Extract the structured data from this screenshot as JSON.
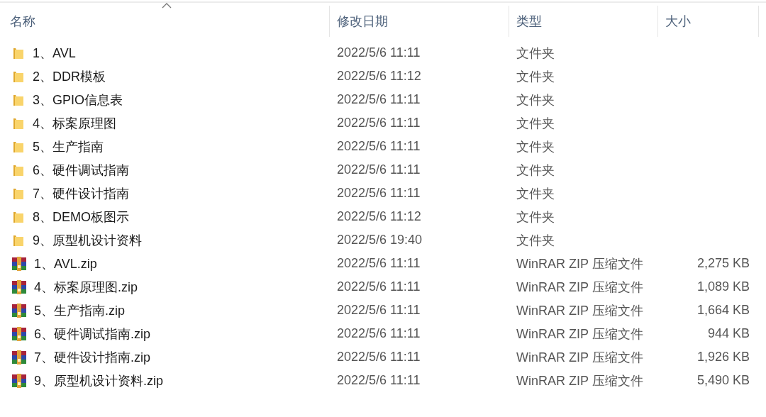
{
  "columns": [
    {
      "label": "名称",
      "sorted": true
    },
    {
      "label": "修改日期",
      "sorted": false
    },
    {
      "label": "类型",
      "sorted": false
    },
    {
      "label": "大小",
      "sorted": false
    }
  ],
  "rows": [
    {
      "kind": "folder",
      "name": "1、AVL",
      "date": "2022/5/6 11:11",
      "type": "文件夹"
    },
    {
      "kind": "folder",
      "name": "2、DDR模板",
      "date": "2022/5/6 11:12",
      "type": "文件夹"
    },
    {
      "kind": "folder",
      "name": "3、GPIO信息表",
      "date": "2022/5/6 11:11",
      "type": "文件夹"
    },
    {
      "kind": "folder",
      "name": "4、标案原理图",
      "date": "2022/5/6 11:11",
      "type": "文件夹"
    },
    {
      "kind": "folder",
      "name": "5、生产指南",
      "date": "2022/5/6 11:11",
      "type": "文件夹"
    },
    {
      "kind": "folder",
      "name": "6、硬件调试指南",
      "date": "2022/5/6 11:11",
      "type": "文件夹"
    },
    {
      "kind": "folder",
      "name": "7、硬件设计指南",
      "date": "2022/5/6 11:11",
      "type": "文件夹"
    },
    {
      "kind": "folder",
      "name": "8、DEMO板图示",
      "date": "2022/5/6 11:12",
      "type": "文件夹"
    },
    {
      "kind": "folder",
      "name": "9、原型机设计资料",
      "date": "2022/5/6 19:40",
      "type": "文件夹"
    },
    {
      "kind": "archive",
      "name": "1、AVL.zip",
      "date": "2022/5/6 11:11",
      "type": "WinRAR ZIP 压缩文件",
      "size": "2,275 KB"
    },
    {
      "kind": "archive",
      "name": "4、标案原理图.zip",
      "date": "2022/5/6 11:11",
      "type": "WinRAR ZIP 压缩文件",
      "size": "1,089 KB"
    },
    {
      "kind": "archive",
      "name": "5、生产指南.zip",
      "date": "2022/5/6 11:11",
      "type": "WinRAR ZIP 压缩文件",
      "size": "1,664 KB"
    },
    {
      "kind": "archive",
      "name": "6、硬件调试指南.zip",
      "date": "2022/5/6 11:11",
      "type": "WinRAR ZIP 压缩文件",
      "size": "944 KB"
    },
    {
      "kind": "archive",
      "name": "7、硬件设计指南.zip",
      "date": "2022/5/6 11:11",
      "type": "WinRAR ZIP 压缩文件",
      "size": "1,926 KB"
    },
    {
      "kind": "archive",
      "name": "9、原型机设计资料.zip",
      "date": "2022/5/6 11:11",
      "type": "WinRAR ZIP 压缩文件",
      "size": "5,490 KB"
    }
  ]
}
